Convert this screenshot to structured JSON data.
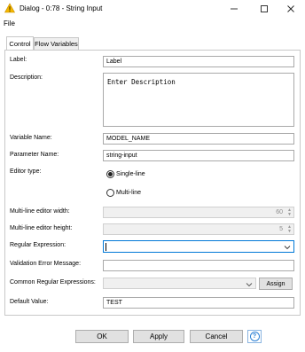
{
  "window": {
    "title": "Dialog - 0:78 - String Input"
  },
  "menu": {
    "file": "File"
  },
  "tabs": {
    "control": "Control",
    "flow_variables": "Flow Variables"
  },
  "form": {
    "label": {
      "label": "Label:",
      "value": "Label"
    },
    "description": {
      "label": "Description:",
      "value": "Enter Description"
    },
    "variable_name": {
      "label": "Variable Name:",
      "value": "MODEL_NAME"
    },
    "parameter_name": {
      "label": "Parameter Name:",
      "value": "string-input"
    },
    "editor_type": {
      "label": "Editor type:",
      "options": [
        "Single-line",
        "Multi-line"
      ],
      "selected": "Single-line"
    },
    "multiline_width": {
      "label": "Multi-line editor width:",
      "value": "60"
    },
    "multiline_height": {
      "label": "Multi-line editor height:",
      "value": "5"
    },
    "regular_expression": {
      "label": "Regular Expression:",
      "value": ""
    },
    "validation_error": {
      "label": "Validation Error Message:",
      "value": ""
    },
    "common_regex": {
      "label": "Common Regular Expressions:",
      "value": "",
      "assign_label": "Assign"
    },
    "default_value": {
      "label": "Default Value:",
      "value": "TEST"
    }
  },
  "buttons": {
    "ok": "OK",
    "apply": "Apply",
    "cancel": "Cancel",
    "help": "?"
  },
  "colors": {
    "accent": "#0078d7",
    "warning_icon": "#f5b800",
    "help": "#2a7fd4"
  },
  "icons": {
    "app": "warning-triangle-icon",
    "minimize": "minimize-icon",
    "maximize": "maximize-icon",
    "close": "close-icon",
    "dropdown": "chevron-down-icon",
    "help": "help-icon"
  }
}
